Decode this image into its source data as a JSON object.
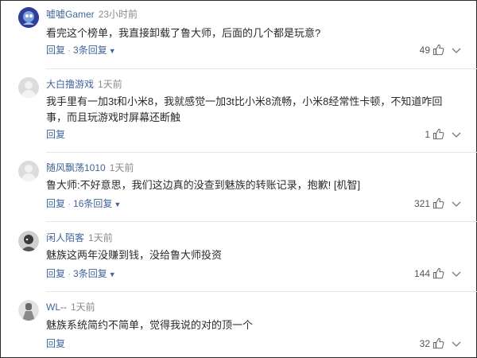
{
  "comments": [
    {
      "username": "嘘嘘Gamer",
      "time": "23小时前",
      "text": "看完这个榜单，我直接卸载了鲁大师，后面的几个都是玩意?",
      "reply_label": "回复",
      "replies_label": "3条回复",
      "likes": "49",
      "avatar": "gamer-avatar"
    },
    {
      "username": "大白撸游戏",
      "time": "1天前",
      "text": "我手里有一加3t和小米8，我就感觉一加3t比小米8流畅，小米8经常性卡顿，不知道咋回事，而且玩游戏时屏幕还断触",
      "reply_label": "回复",
      "replies_label": "",
      "likes": "1",
      "avatar": "default-avatar"
    },
    {
      "username": "随风飘荡1010",
      "time": "1天前",
      "text": "鲁大师:不好意思，我们这边真的没查到魅族的转账记录，抱歉! [机智]",
      "reply_label": "回复",
      "replies_label": "16条回复",
      "likes": "321",
      "avatar": "default-avatar"
    },
    {
      "username": "闲人陌客",
      "time": "1天前",
      "text": "魅族这两年没赚到钱，没给鲁大师投资",
      "reply_label": "回复",
      "replies_label": "3条回复",
      "likes": "144",
      "avatar": "photo-avatar"
    },
    {
      "username": "WL--",
      "time": "1天前",
      "text": "魅族系统简约不简单，觉得我说的对的顶一个",
      "reply_label": "回复",
      "replies_label": "",
      "likes": "32",
      "avatar": "photo-avatar-2"
    }
  ],
  "colors": {
    "username": "#406599",
    "action": "#406599",
    "time": "#8a8a8a",
    "divider": "#e6e6e6"
  },
  "icons": {
    "like": "thumbs-up-icon",
    "more": "more-icon",
    "expand": "chevron-down-icon"
  }
}
